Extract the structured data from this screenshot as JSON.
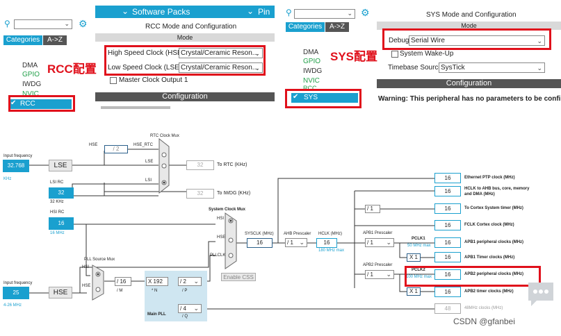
{
  "left_panel": {
    "header": "Software Packs",
    "header_right": "Pin",
    "tabs": [
      "Categories",
      "A->Z"
    ],
    "categories": [
      "DMA",
      "GPIO",
      "IWDG",
      "NVIC",
      "RCC"
    ],
    "title": "RCC Mode and Configuration",
    "mode_header": "Mode",
    "hse_label": "High Speed Clock (HSE)",
    "hse_value": "Crystal/Ceramic Reson...",
    "lse_label": "Low Speed Clock (LSE)",
    "lse_value": "Crystal/Ceramic Reson...",
    "mco_label": "Master Clock Output 1",
    "config_header": "Configuration",
    "annotation": "RCC配置"
  },
  "right_panel": {
    "tabs": [
      "Categories",
      "A->Z"
    ],
    "categories": [
      "DMA",
      "GPIO",
      "IWDG",
      "NVIC",
      "RCC",
      "SYS"
    ],
    "title": "SYS Mode and Configuration",
    "mode_header": "Mode",
    "debug_label": "Debug",
    "debug_value": "Serial Wire",
    "wakeup_label": "System Wake-Up",
    "timebase_label": "Timebase Source",
    "timebase_value": "SysTick",
    "config_header": "Configuration",
    "warning": "Warning: This peripheral has no parameters to be config",
    "annotation": "SYS配置"
  },
  "clock": {
    "input_freq_label": "Input frequency",
    "lse_freq": "32.768",
    "lse_unit": "KHz",
    "lse_label": "LSE",
    "lsi_rc_label": "LSI RC",
    "lsi_value": "32",
    "lsi_unit": "32 KHz",
    "hsi_rc_label": "HSI RC",
    "hsi_value": "16",
    "hsi_unit": "16 MHz",
    "hse_freq": "25",
    "hse_range": "4-26 MHz",
    "hse_label": "HSE",
    "rtc_mux_label": "RTC Clock Mux",
    "rtc_hse": "HSE",
    "rtc_div": "/ 2",
    "rtc_hse_rtc": "HSE_RTC",
    "rtc_lse": "LSE",
    "rtc_lsi": "LSI",
    "rtc_out": "32",
    "rtc_out_label": "To RTC (KHz)",
    "iwdg_out": "32",
    "iwdg_out_label": "To IWDG (KHz)",
    "sys_mux_label": "System Clock Mux",
    "mux_hsi": "HSI",
    "mux_hse": "HSE",
    "mux_pllclk": "PLLCLK",
    "sysclk_label": "SYSCLK (MHz)",
    "sysclk_value": "16",
    "ahb_label": "AHB Prescaler",
    "ahb_value": "/ 1",
    "hclk_label": "HCLK (MHz)",
    "hclk_value": "16",
    "hclk_max": "180 MHz max",
    "enable_css": "Enable CSS",
    "pll_mux_label": "PLL Source Mux",
    "pll_hsi": "HSI",
    "pll_hse": "HSE",
    "pll_m": "/ 16",
    "pll_m_label": "/ M",
    "pll_n": "X 192",
    "pll_n_label": "* N",
    "pll_p": "/ 2",
    "pll_p_label": "/ P",
    "pll_q": "/ 4",
    "pll_q_label": "/ Q",
    "main_pll": "Main PLL",
    "apb1_label": "APB1 Prescaler",
    "apb1_value": "/ 1",
    "pclk1": "PCLK1",
    "pclk1_max": "50 MHz max",
    "apb1_timer_mult": "X 1",
    "apb2_label": "APB2 Prescaler",
    "apb2_value": "/ 1",
    "pclk2": "PCLK2",
    "pclk2_max": "100 MHz max",
    "apb2_timer_mult": "X 1",
    "cortex_div": "/ 1",
    "outputs": [
      {
        "value": "16",
        "label": "Ethernet PTP clock (MHz)"
      },
      {
        "value": "16",
        "label": "HCLK to AHB bus, core, memory and DMA (MHz)"
      },
      {
        "value": "16",
        "label": "To Cortex System timer (MHz)"
      },
      {
        "value": "16",
        "label": "FCLK Cortex clock (MHz)"
      },
      {
        "value": "16",
        "label": "APB1 peripheral clocks (MHz)"
      },
      {
        "value": "16",
        "label": "APB1 Timer clocks (MHz)"
      },
      {
        "value": "16",
        "label": "APB2 peripheral clocks (MHz)"
      },
      {
        "value": "16",
        "label": "APB2 timer clocks (MHz)"
      },
      {
        "value": "48",
        "label": "48MHz clocks (MHz)"
      }
    ]
  },
  "watermark": "CSDN @gfanbei"
}
